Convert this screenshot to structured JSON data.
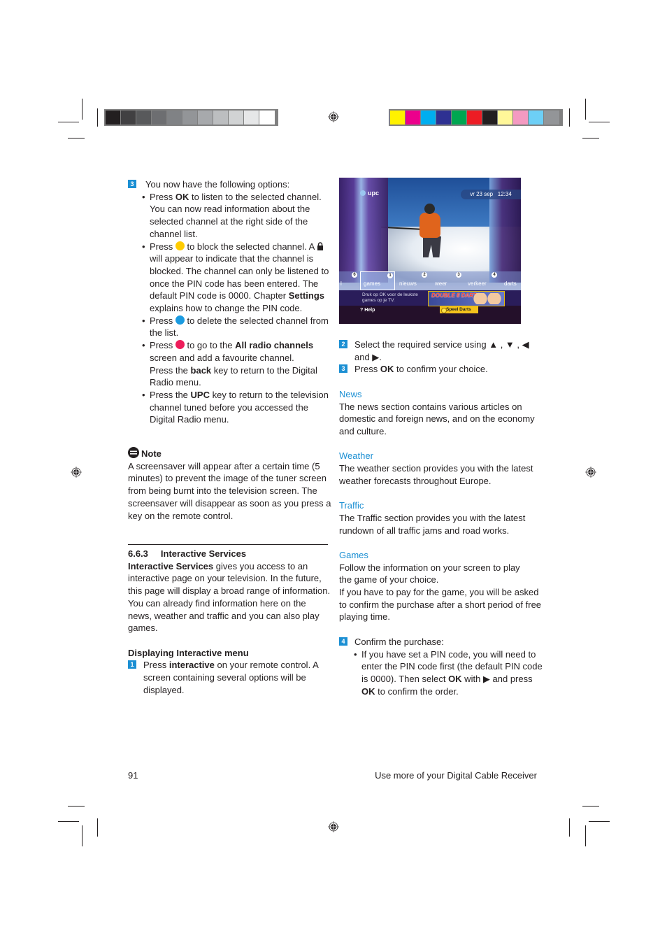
{
  "print_marks": {
    "gray_scale": [
      "#231f20",
      "#414042",
      "#58595b",
      "#6d6e71",
      "#808285",
      "#939598",
      "#a7a9ac",
      "#bcbec0",
      "#d1d3d4",
      "#e6e7e8",
      "#ffffff"
    ],
    "color_scale": [
      "#fff200",
      "#ec008c",
      "#00aeef",
      "#2e3192",
      "#00a651",
      "#ed1c24",
      "#231f20",
      "#fff799",
      "#f49ac1",
      "#6dcff6",
      "#939598"
    ]
  },
  "left_column": {
    "step3": {
      "number": "3",
      "intro": "You now have the following options:",
      "bullets": [
        {
          "pre": "Press ",
          "bold": "OK",
          "post": " to listen to the selected channel. You can now read information about the selected channel at the right side of the channel list."
        },
        {
          "pre": "Press ",
          "dot_color": "#ffcc00",
          "mid": " to block the selected channel. A ",
          "lock_icon": "lock-icon",
          "post": " will appear to indicate that the channel is blocked. The channel can only be listened to once the PIN code has been entered. The default PIN code is 0000. Chapter ",
          "bold2": "Settings",
          "post2": " explains how to change the PIN code."
        },
        {
          "pre": "Press ",
          "dot_color": "#1b9be0",
          "post": " to delete the selected channel from the list."
        },
        {
          "pre": "Press ",
          "dot_color": "#ee1c5a",
          "mid": " to go to the ",
          "bold": "All radio channels",
          "post": " screen and add a favourite channel.",
          "line2_pre": "Press the ",
          "line2_bold": "back",
          "line2_post": " key to return to the Digital Radio menu."
        },
        {
          "pre": "Press the ",
          "bold": "UPC",
          "post": " key to return to the television channel tuned before you accessed the Digital Radio menu."
        }
      ]
    },
    "note": {
      "title": "Note",
      "icon": "note-icon",
      "text": "A screensaver will appear after a certain time (5 minutes) to prevent the image of the tuner screen from being burnt into the television screen. The screensaver will disappear as soon as you press a key on the remote control."
    },
    "section": {
      "number": "6.6.3",
      "title": "Interactive Services",
      "intro_bold": "Interactive Services",
      "intro_text": " gives you access to an interactive page on your television. In the future, this page will display a broad range of information. You can already find information here on the news, weather and traffic and you can also play games.",
      "subheading": "Displaying Interactive menu",
      "step1": {
        "number": "1",
        "pre": "Press ",
        "bold": "interactive",
        "post": " on your remote control. A screen containing several options will be displayed."
      }
    }
  },
  "tv_screen": {
    "logo": "upc",
    "date": "vr 23 sep",
    "time": "12:34",
    "menu": [
      {
        "label": "l",
        "badge": "6"
      },
      {
        "label": "games",
        "badge": "1",
        "selected": true
      },
      {
        "label": "nieuws",
        "badge": "2"
      },
      {
        "label": "weer",
        "badge": "3"
      },
      {
        "label": "verkeer",
        "badge": "4"
      },
      {
        "label": "darts",
        "badge": ""
      }
    ],
    "hint": "Druk op OK voor de leukste games op je TV.",
    "help": "? Help",
    "promo_title": "DOUBLE 8 DARTS",
    "cta": "Speel Darts"
  },
  "right_column": {
    "step2": {
      "number": "2",
      "text": "Select the required service using ▲ , ▼ , ◀ and ▶."
    },
    "step3": {
      "number": "3",
      "pre": "Press ",
      "bold": "OK",
      "post": " to confirm your choice."
    },
    "news": {
      "heading": "News",
      "text": "The news section contains various articles on domestic and foreign news, and on the economy and culture."
    },
    "weather": {
      "heading": "Weather",
      "text": "The weather section provides you with the latest weather forecasts throughout Europe."
    },
    "traffic": {
      "heading": "Traffic",
      "text": "The Traffic section provides you with the latest rundown of all traffic jams and road works."
    },
    "games": {
      "heading": "Games",
      "text1": "Follow the information on your screen to play the game of your choice.",
      "text2": "If you have to pay for the game, you will be asked to confirm the purchase after a short period of free playing time."
    },
    "step4": {
      "number": "4",
      "intro": "Confirm the purchase:",
      "bullet": {
        "pre": "If you have set a PIN code, you will need to enter the PIN code first (the default PIN code is 0000). Then select ",
        "bold": "OK",
        "mid": " with ▶ and press ",
        "bold2": "OK",
        "post": " to confirm the order."
      }
    }
  },
  "footer": {
    "page_number": "91",
    "running_title": "Use more of your Digital Cable Receiver"
  }
}
